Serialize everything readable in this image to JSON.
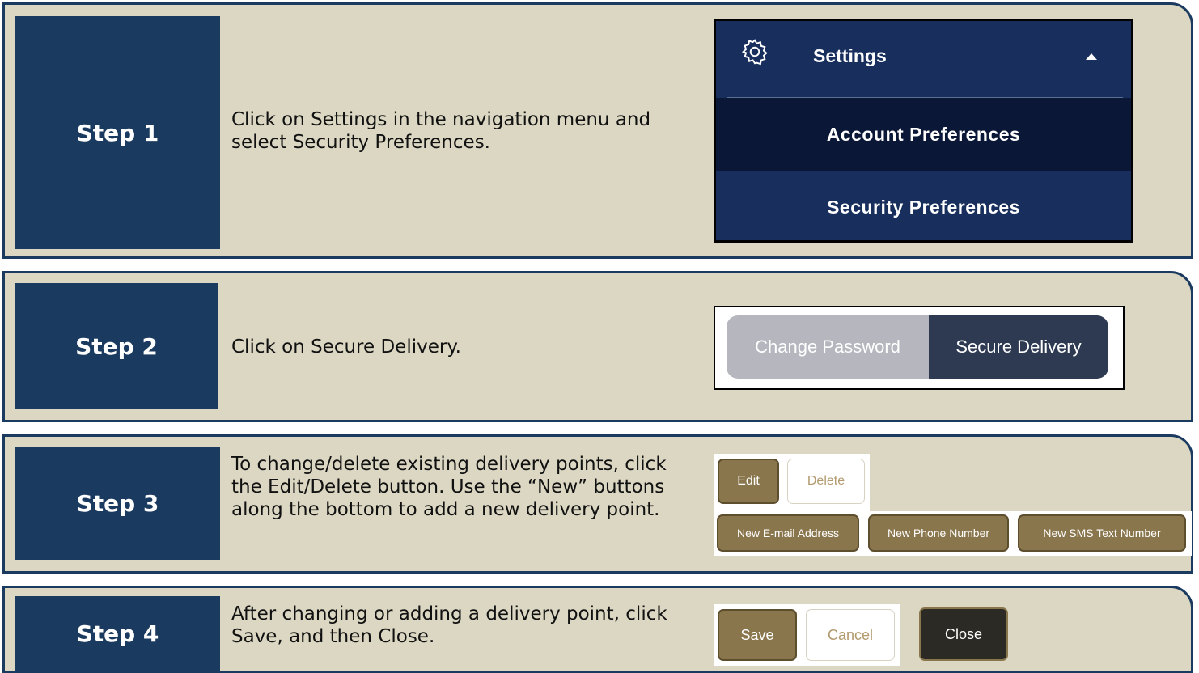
{
  "steps": [
    {
      "label": "Step 1",
      "text": "Click on Settings in the navigation menu and select Security Preferences."
    },
    {
      "label": "Step 2",
      "text": "Click on Secure Delivery."
    },
    {
      "label": "Step 3",
      "text": "To change/delete existing delivery points, click the Edit/Delete button. Use the “New” buttons along the bottom to add a new delivery point."
    },
    {
      "label": "Step 4",
      "text": "After changing or adding a delivery point, click Save, and then Close."
    }
  ],
  "settings_menu": {
    "title": "Settings",
    "items": [
      "Account Preferences",
      "Security Preferences"
    ]
  },
  "tabs": [
    "Change Password",
    "Secure Delivery"
  ],
  "step3_buttons": {
    "edit": "Edit",
    "delete": "Delete",
    "new_email": "New E-mail Address",
    "new_phone": "New Phone Number",
    "new_sms": "New SMS Text Number"
  },
  "step4_buttons": {
    "save": "Save",
    "cancel": "Cancel",
    "close": "Close"
  },
  "colors": {
    "panel_bg": "#dbd7c2",
    "navy": "#1b3a5f",
    "gold": "#8a764d"
  }
}
